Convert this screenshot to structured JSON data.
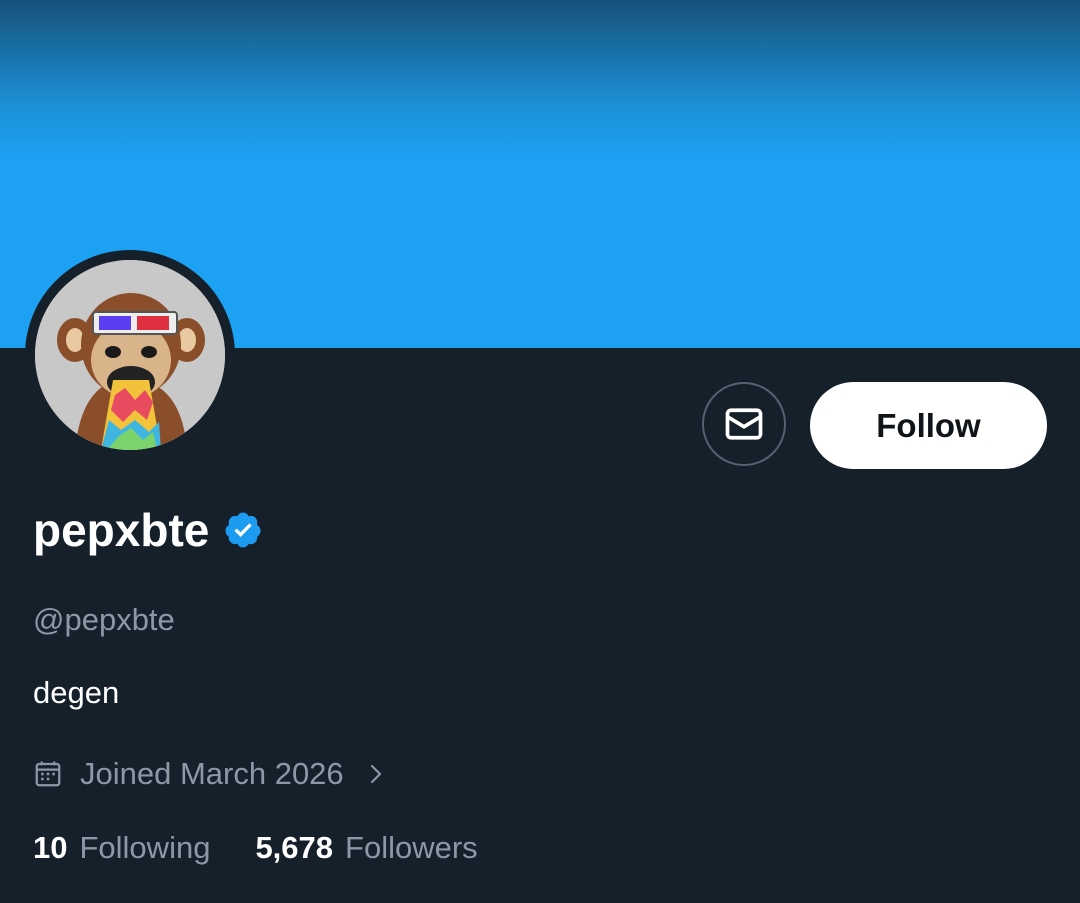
{
  "profile": {
    "display_name": "pepxbte",
    "handle": "@pepxbte",
    "bio": "degen",
    "verified": true,
    "joined": "Joined March 2026",
    "avatar_icon": "ape-avatar-3d-glasses"
  },
  "actions": {
    "message_icon": "envelope-icon",
    "follow_label": "Follow"
  },
  "stats": {
    "following_count": "10",
    "following_label": "Following",
    "followers_count": "5,678",
    "followers_label": "Followers"
  },
  "colors": {
    "background": "#15202b",
    "banner": "#1da1f2",
    "secondary_text": "#8b98a5",
    "verified_badge": "#1d9bf0"
  }
}
